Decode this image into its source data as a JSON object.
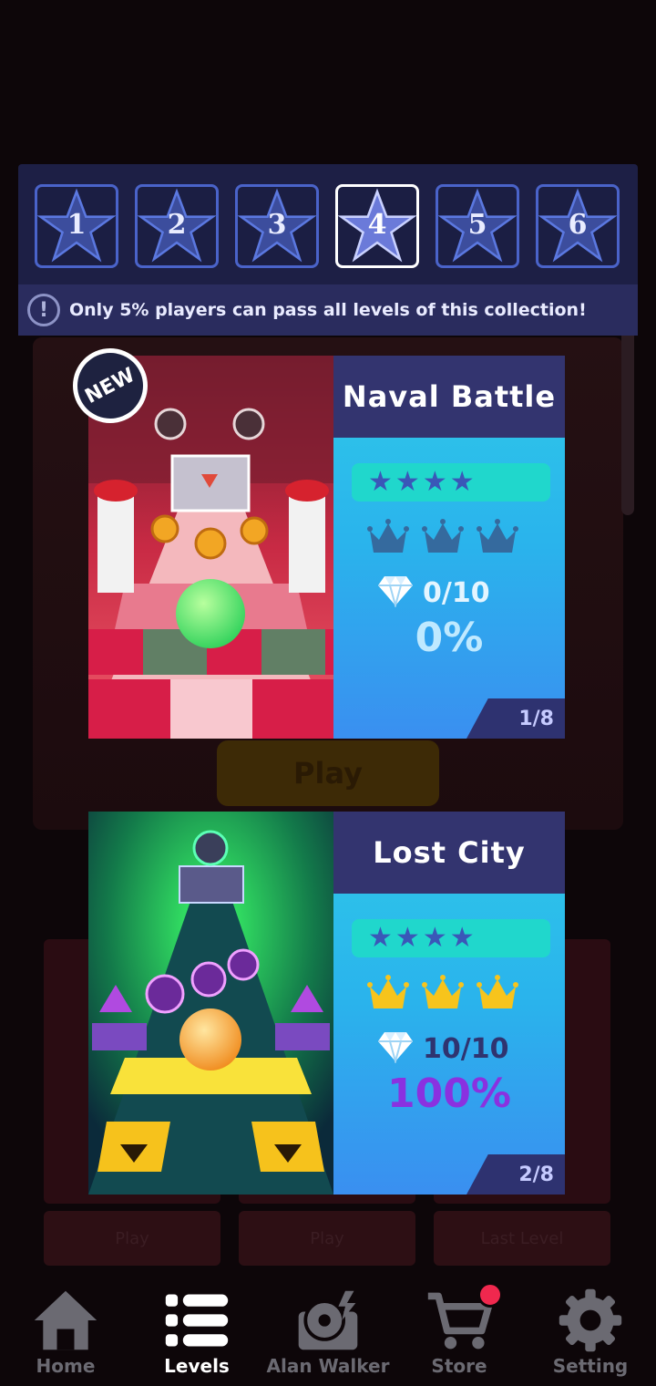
{
  "collection": {
    "star_tabs": [
      {
        "label": "1",
        "active": false
      },
      {
        "label": "2",
        "active": false
      },
      {
        "label": "3",
        "active": false
      },
      {
        "label": "4",
        "active": true
      },
      {
        "label": "5",
        "active": false
      },
      {
        "label": "6",
        "active": false
      }
    ],
    "notice_icon": "!",
    "notice": "Only 5%  players can pass all levels of this collection!"
  },
  "levels": [
    {
      "title": "Naval Battle",
      "badge": "NEW",
      "difficulty_stars": 4,
      "crowns_earned": 0,
      "crowns_total": 3,
      "gems": "0/10",
      "percent": "0%",
      "page": "1/8"
    },
    {
      "title": "Lost City",
      "difficulty_stars": 4,
      "crowns_earned": 3,
      "crowns_total": 3,
      "gems": "10/10",
      "percent": "100%",
      "page": "2/8"
    }
  ],
  "background": {
    "play_label": "Play",
    "row_buttons": [
      "Play",
      "Play",
      "Last Level"
    ]
  },
  "nav": {
    "items": [
      {
        "label": "Home",
        "icon": "home-icon",
        "active": false
      },
      {
        "label": "Levels",
        "icon": "levels-list-icon",
        "active": true
      },
      {
        "label": "Alan Walker",
        "icon": "dj-turntable-icon",
        "active": false
      },
      {
        "label": "Store",
        "icon": "cart-icon",
        "active": false
      },
      {
        "label": "Setting",
        "icon": "gear-icon",
        "active": false
      }
    ]
  },
  "colors": {
    "accent_crown": "#f7c41c",
    "crown_empty": "#356a9e",
    "notification": "#f0284e",
    "panel": "#1d1f45"
  }
}
